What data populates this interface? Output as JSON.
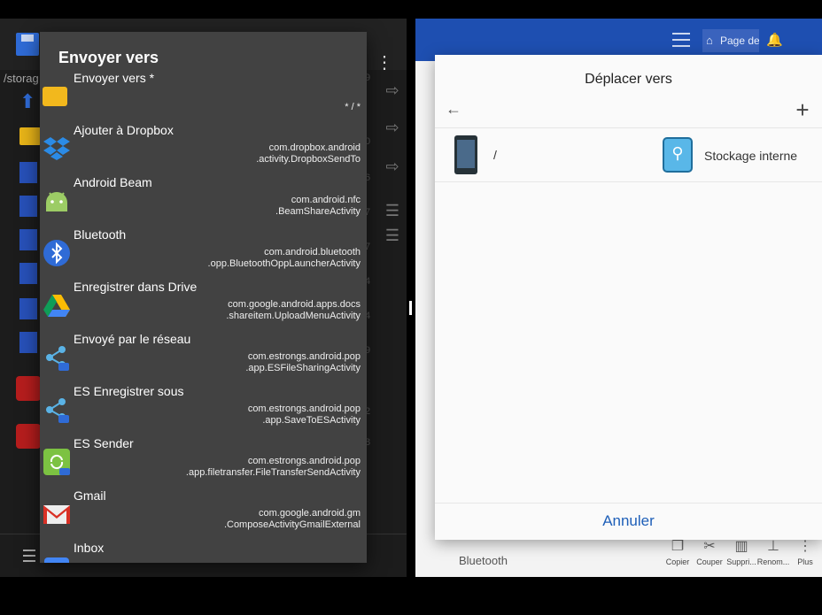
{
  "left_app": {
    "path_text": "/storag",
    "row_numbers": [
      "9",
      "0",
      "6",
      "7",
      "7",
      "4",
      "4",
      "9",
      "2",
      "8"
    ]
  },
  "send_dialog": {
    "title": "Envoyer vers",
    "items": [
      {
        "name": "Envoyer vers *",
        "pkg1": "",
        "pkg2": "* / *",
        "icon": "folder-icon"
      },
      {
        "name": "Ajouter à Dropbox",
        "pkg1": "com.dropbox.android",
        "pkg2": ".activity.DropboxSendTo",
        "icon": "dropbox-icon"
      },
      {
        "name": "Android Beam",
        "pkg1": "com.android.nfc",
        "pkg2": ".BeamShareActivity",
        "icon": "android-icon"
      },
      {
        "name": "Bluetooth",
        "pkg1": "com.android.bluetooth",
        "pkg2": ".opp.BluetoothOppLauncherActivity",
        "icon": "bluetooth-icon"
      },
      {
        "name": "Enregistrer dans Drive",
        "pkg1": "com.google.android.apps.docs",
        "pkg2": ".shareitem.UploadMenuActivity",
        "icon": "drive-icon"
      },
      {
        "name": "Envoyé par le réseau",
        "pkg1": "com.estrongs.android.pop",
        "pkg2": ".app.ESFileSharingActivity",
        "icon": "share-icon"
      },
      {
        "name": "ES Enregistrer sous",
        "pkg1": "com.estrongs.android.pop",
        "pkg2": ".app.SaveToESActivity",
        "icon": "share-icon"
      },
      {
        "name": "ES Sender",
        "pkg1": "com.estrongs.android.pop",
        "pkg2": ".app.filetransfer.FileTransferSendActivity",
        "icon": "es-sender-icon"
      },
      {
        "name": "Gmail",
        "pkg1": "com.google.android.gm",
        "pkg2": ".ComposeActivityGmailExternal",
        "icon": "gmail-icon"
      },
      {
        "name": "Inbox",
        "pkg1": "",
        "pkg2": "",
        "icon": "inbox-icon"
      }
    ]
  },
  "right_app": {
    "header_chip": "Page de",
    "bottom_label": "Bluetooth",
    "tools": [
      {
        "label": "Copier",
        "icon": "copy-icon"
      },
      {
        "label": "Couper",
        "icon": "cut-icon"
      },
      {
        "label": "Suppri...",
        "icon": "trash-icon"
      },
      {
        "label": "Renom...",
        "icon": "rename-icon"
      },
      {
        "label": "Plus",
        "icon": "more-icon"
      }
    ]
  },
  "move_dialog": {
    "title": "Déplacer vers",
    "path": "/",
    "storage_label": "Stockage interne",
    "cancel_label": "Annuler"
  },
  "colors": {
    "accent_blue": "#1e5fb8",
    "header_blue": "#1e4fb1",
    "dialog_dark": "#424242"
  }
}
